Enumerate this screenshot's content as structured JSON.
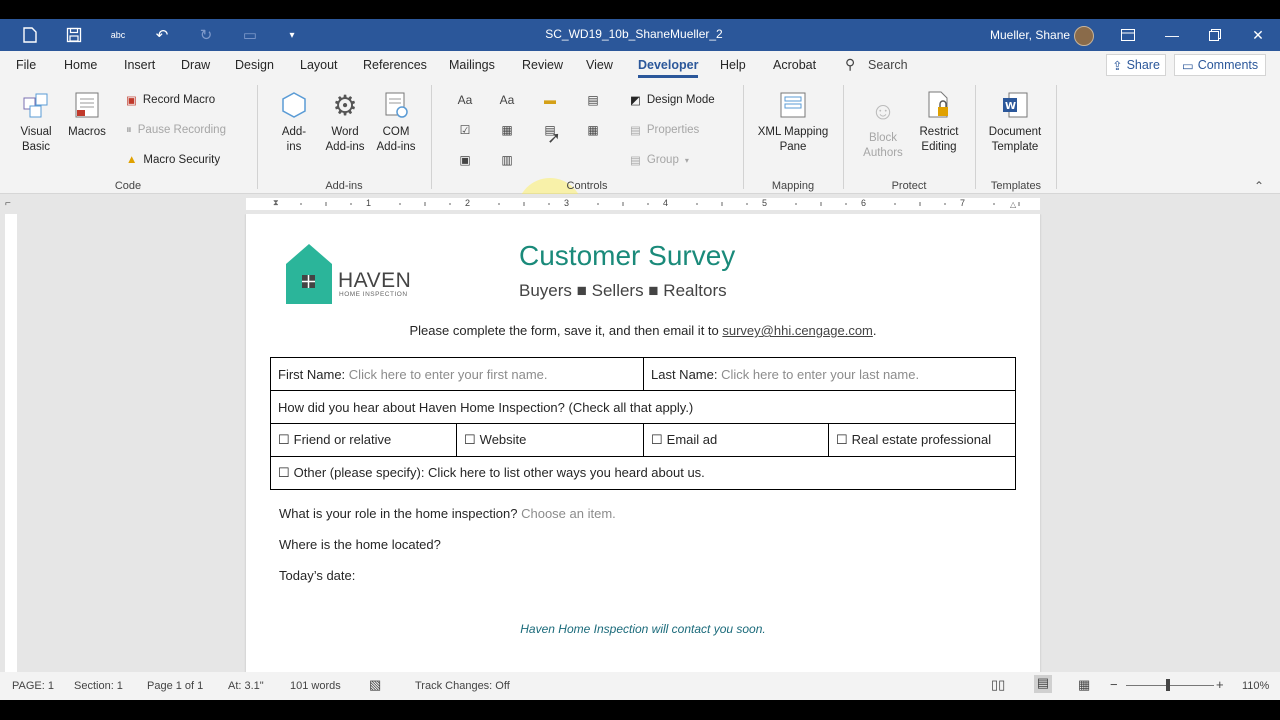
{
  "window": {
    "title": "SC_WD19_10b_ShaneMueller_2",
    "user": "Mueller, Shane"
  },
  "tabs": [
    "File",
    "Home",
    "Insert",
    "Draw",
    "Design",
    "Layout",
    "References",
    "Mailings",
    "Review",
    "View",
    "Developer",
    "Help",
    "Acrobat"
  ],
  "active_tab": "Developer",
  "search": {
    "label": "Search"
  },
  "share": {
    "label": "Share"
  },
  "comments": {
    "label": "Comments"
  },
  "ribbon": {
    "code": {
      "label": "Code",
      "visual_basic": "Visual\nBasic",
      "macros": "Macros",
      "record_macro": "Record Macro",
      "pause_recording": "Pause Recording",
      "macro_security": "Macro Security"
    },
    "addins": {
      "label": "Add-ins",
      "addins": "Add-\nins",
      "word_addins": "Word\nAdd-ins",
      "com_addins": "COM\nAdd-ins"
    },
    "controls": {
      "label": "Controls",
      "design_mode": "Design Mode",
      "properties": "Properties",
      "group": "Group"
    },
    "mapping": {
      "label": "Mapping",
      "xml_pane": "XML Mapping\nPane"
    },
    "protect": {
      "label": "Protect",
      "block_authors": "Block\nAuthors",
      "restrict_editing": "Restrict\nEditing"
    },
    "templates": {
      "label": "Templates",
      "document_template": "Document\nTemplate"
    }
  },
  "ruler": {
    "numbers": [
      "1",
      "2",
      "3",
      "4",
      "5",
      "6",
      "7"
    ]
  },
  "document": {
    "logo_text": "HAVEN",
    "logo_sub": "HOME INSPECTION",
    "title": "Customer Survey",
    "subtitle": "Buyers ■ Sellers ■ Realtors",
    "instruction": "Please complete the form, save it, and then email it to ",
    "email": "survey@hhi.cengage.com",
    "instruction_end": ".",
    "first_name_label": "First Name:",
    "first_name_ph": "Click here to enter your first name.",
    "last_name_label": "Last Name:",
    "last_name_ph": "Click here to enter your last name.",
    "hear_question": "How did you hear about Haven Home Inspection? (Check all that apply.)",
    "checkbox_glyph": "☐",
    "opt_friend": "Friend or relative",
    "opt_website": "Website",
    "opt_email": "Email ad",
    "opt_realestate": "Real estate professional",
    "opt_other": "Other (please specify): Click here to list other ways you heard about us.",
    "role_q": "What is your role in the home inspection?",
    "role_ph": "Choose an item.",
    "location_q": "Where is the home located?",
    "date_q": "Today’s date:",
    "closing": "Haven Home Inspection will contact you soon."
  },
  "status": {
    "page": "PAGE: 1",
    "section": "Section: 1",
    "page_of": "Page 1 of 1",
    "at": "At: 3.1\"",
    "words": "101 words",
    "track": "Track Changes: Off",
    "zoom": "110%"
  },
  "colors": {
    "titlebar": "#2b579a",
    "accent_teal": "#1a8a7a",
    "logo_green": "#2bb59a"
  }
}
